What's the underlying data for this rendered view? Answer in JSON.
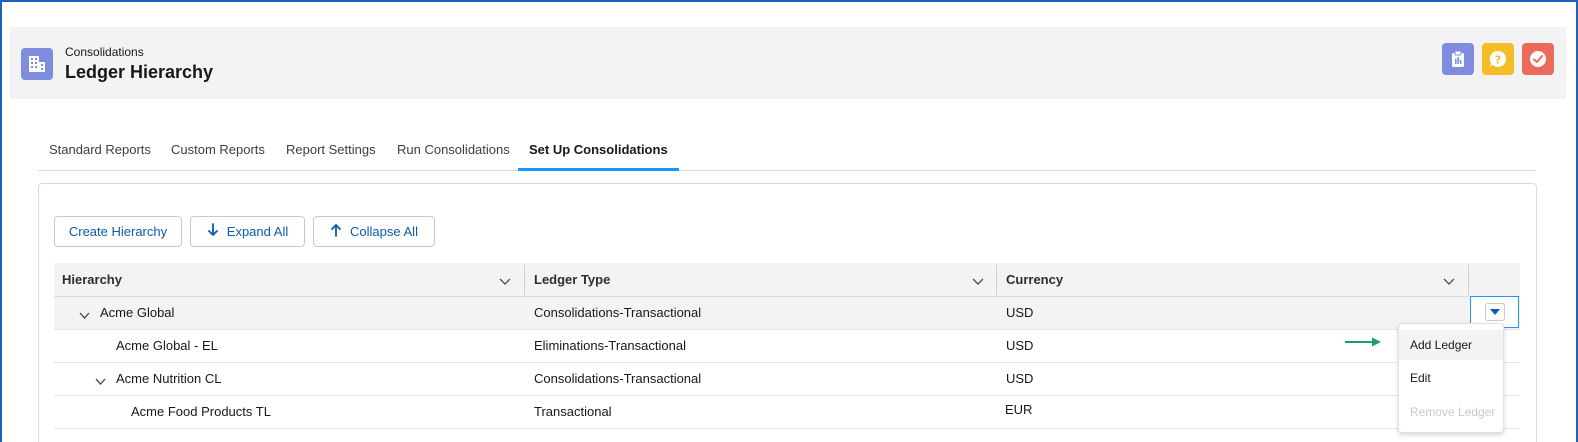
{
  "header": {
    "subtitle": "Consolidations",
    "title": "Ledger Hierarchy",
    "app_icon": "building-icon",
    "actions": [
      {
        "icon": "clipboard-icon",
        "color": "#7f8de1"
      },
      {
        "icon": "help-icon",
        "color": "#f4bc25"
      },
      {
        "icon": "check-circle-icon",
        "color": "#ea6b5b"
      }
    ]
  },
  "tabs": [
    {
      "label": "Standard Reports",
      "active": false
    },
    {
      "label": "Custom Reports",
      "active": false
    },
    {
      "label": "Report Settings",
      "active": false
    },
    {
      "label": "Run Consolidations",
      "active": false
    },
    {
      "label": "Set Up Consolidations",
      "active": true
    }
  ],
  "toolbar": {
    "create_label": "Create Hierarchy",
    "expand_label": "Expand All",
    "collapse_label": "Collapse All"
  },
  "table": {
    "columns": [
      "Hierarchy",
      "Ledger Type",
      "Currency"
    ],
    "rows": [
      {
        "name": "Acme Global",
        "type": "Consolidations-Transactional",
        "currency": "USD",
        "expanded": true,
        "level": 1
      },
      {
        "name": "Acme Global - EL",
        "type": "Eliminations-Transactional",
        "currency": "USD",
        "level": 2
      },
      {
        "name": "Acme Nutrition CL",
        "type": "Consolidations-Transactional",
        "currency": "USD",
        "expanded": true,
        "level": 2
      },
      {
        "name": "Acme Food Products TL",
        "type": "Transactional",
        "currency": "EUR",
        "level": 3
      }
    ]
  },
  "row_menu": {
    "items": [
      {
        "label": "Add Ledger",
        "highlighted": true,
        "disabled": false
      },
      {
        "label": "Edit",
        "highlighted": false,
        "disabled": false
      },
      {
        "label": "Remove Ledger",
        "highlighted": false,
        "disabled": true
      }
    ]
  },
  "colors": {
    "accent": "#1b96ff",
    "brand_icon": "#7f8de1",
    "link": "#0b5cab",
    "arrow": "#1a9e78"
  }
}
